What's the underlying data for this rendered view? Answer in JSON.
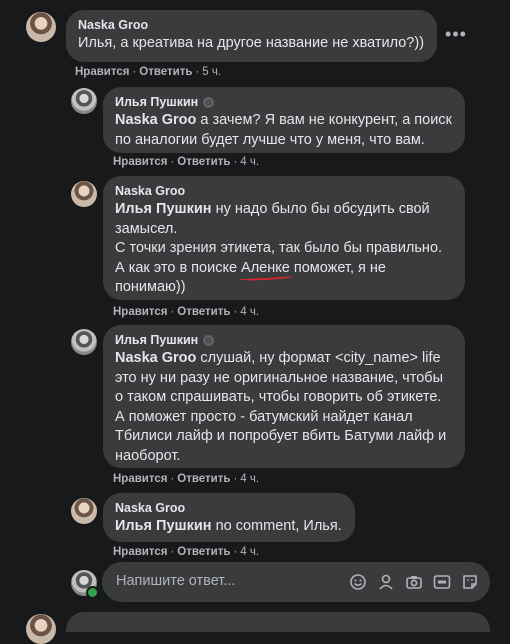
{
  "comments": [
    {
      "author": "Naska Groo",
      "text": "Илья, а креатива на другое название не хватило?))",
      "like": "Нравится",
      "reply": "Ответить",
      "time": "5 ч."
    },
    {
      "author": "Илья Пушкин",
      "mention": "Naska Groo",
      "text": " а зачем? Я вам не конкурент, а поиск по аналогии будет лучше что у меня, что вам.",
      "like": "Нравится",
      "reply": "Ответить",
      "time": "4 ч."
    },
    {
      "author": "Naska Groo",
      "mention": "Илья Пушкин",
      "text_a": " ну надо было бы обсудить свой замысел.",
      "text_b": "С точки зрения этикета, так было бы правильно.",
      "text_c1": "А как это в поиске ",
      "text_c_under": "Аленке",
      "text_c2": " поможет, я не понимаю))",
      "like": "Нравится",
      "reply": "Ответить",
      "time": "4 ч."
    },
    {
      "author": "Илья Пушкин",
      "mention": "Naska Groo",
      "text": " слушай, ну формат <city_name> life это ну ни разу не оригинальное название, чтобы о таком спрашивать, чтобы говорить об этикете. А поможет просто - батумский найдет канал Тбилиси лайф и попробует вбить Батуми лайф и наоборот.",
      "like": "Нравится",
      "reply": "Ответить",
      "time": "4 ч."
    },
    {
      "author": "Naska Groo",
      "mention": "Илья Пушкин",
      "text": " no comment, Илья.",
      "like": "Нравится",
      "reply": "Ответить",
      "time": "4 ч."
    }
  ],
  "separator": "·",
  "more_icon": "more-horizontal-icon",
  "reply_box": {
    "placeholder": "Напишите ответ...",
    "icons": [
      "emoji-icon",
      "avatar-sticker-icon",
      "camera-icon",
      "gif-icon",
      "sticker-icon"
    ]
  },
  "colors": {
    "background": "#18191a",
    "bubble": "#3a3b3c",
    "text": "#e4e6eb",
    "secondary": "#b0b3b8",
    "underline": "#d3272b",
    "online": "#31a24c"
  }
}
